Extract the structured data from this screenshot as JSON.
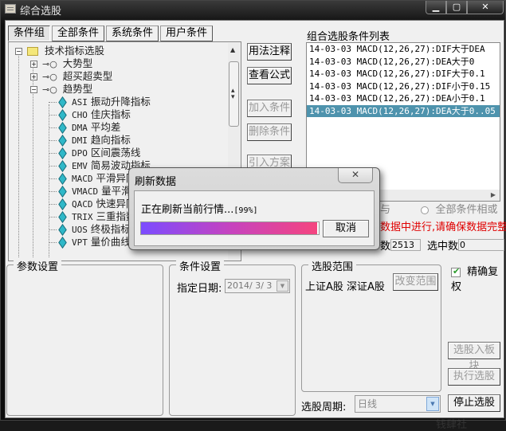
{
  "window": {
    "title": "综合选股",
    "controls": {
      "minimize": "▁",
      "maximize": "▢",
      "close": "✕"
    }
  },
  "tabs": [
    {
      "label": "条件组",
      "active": true
    },
    {
      "label": "全部条件",
      "active": false
    },
    {
      "label": "系统条件",
      "active": false
    },
    {
      "label": "用户条件",
      "active": false
    }
  ],
  "tree": {
    "root": {
      "label": "技术指标选股",
      "expander": "−"
    },
    "groups": [
      {
        "label": "大势型",
        "expander": "+"
      },
      {
        "label": "超买超卖型",
        "expander": "+"
      },
      {
        "label": "趋势型",
        "expander": "−"
      }
    ],
    "leaves": [
      {
        "code": "ASI",
        "name": "振动升降指标"
      },
      {
        "code": "CHO",
        "name": "佳庆指标"
      },
      {
        "code": "DMA",
        "name": "平均差"
      },
      {
        "code": "DMI",
        "name": "趋向指标"
      },
      {
        "code": "DPO",
        "name": "区间震荡线"
      },
      {
        "code": "EMV",
        "name": "简易波动指标"
      },
      {
        "code": "MACD",
        "name": "平滑异同"
      },
      {
        "code": "VMACD",
        "name": "量平滑"
      },
      {
        "code": "QACD",
        "name": "快速异同"
      },
      {
        "code": "TRIX",
        "name": "三重指数"
      },
      {
        "code": "UOS",
        "name": "终极指标"
      },
      {
        "code": "VPT",
        "name": "量价曲线"
      }
    ]
  },
  "buttons": {
    "usage_notes": "用法注释",
    "view_formula": "查看公式",
    "add_condition": "加入条件",
    "delete_condition": "删除条件",
    "import_scheme": "引入方案",
    "change_scope": "改变范围",
    "to_block": "选股入板块",
    "execute": "执行选股",
    "stop": "停止选股"
  },
  "condition_list": {
    "label": "组合选股条件列表",
    "items": [
      {
        "text": "14-03-03 MACD(12,26,27):DIF大于DEA",
        "selected": false
      },
      {
        "text": "14-03-03 MACD(12,26,27):DEA大于0",
        "selected": false
      },
      {
        "text": "14-03-03 MACD(12,26,27):DIF大于0.1",
        "selected": false
      },
      {
        "text": "14-03-03 MACD(12,26,27):DIF小于0.15",
        "selected": false
      },
      {
        "text": "14-03-03 MACD(12,26,27):DEA小于0.1",
        "selected": false
      },
      {
        "text": "14-03-03 MACD(12,26,27):DEA大于0..05",
        "selected": true
      }
    ]
  },
  "logic": {
    "and_label_partial": "与",
    "or_label": "全部条件相或"
  },
  "warning": "数据中进行,请确保数据完整",
  "stats": {
    "total_label_partial": "数",
    "total_value": "2513",
    "selected_label": "选中数",
    "selected_value": "0"
  },
  "params": {
    "title": "参数设置"
  },
  "condition_settings": {
    "title": "条件设置",
    "date_label": "指定日期:",
    "date_value": "2014/ 3/ 3"
  },
  "scope": {
    "title": "选股范围",
    "markets": "上证A股 深证A股"
  },
  "adjust": {
    "label": "精确复权",
    "checked": true
  },
  "period": {
    "label": "选股周期:",
    "value": "日线"
  },
  "dialog": {
    "title": "刷新数据",
    "message": "正在刷新当前行情...",
    "percent_text": "[99%]",
    "progress": 0.99,
    "cancel": "取消",
    "close": "✕"
  },
  "watermark": "钱肆社"
}
